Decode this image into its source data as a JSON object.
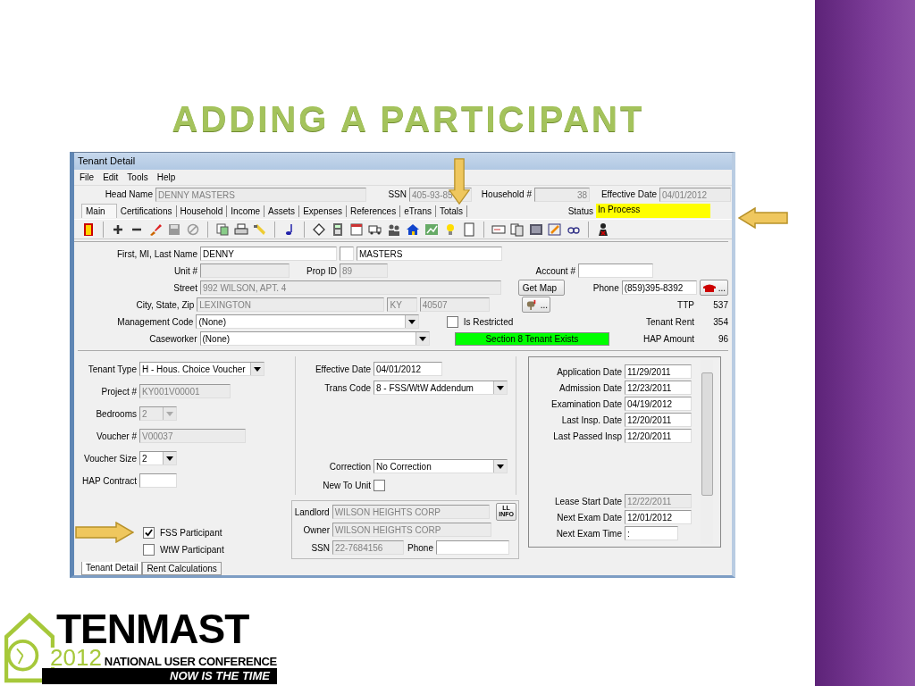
{
  "slide": {
    "title": "ADDING A PARTICIPANT"
  },
  "window": {
    "title": "Tenant Detail"
  },
  "menu": [
    "File",
    "Edit",
    "Tools",
    "Help"
  ],
  "header": [
    {
      "label": "Head Name",
      "value": "DENNY MASTERS",
      "disabled": true
    },
    {
      "label": "SSN",
      "value": "405-93-85",
      "disabled": true
    },
    {
      "label": "Household #",
      "value": "38",
      "disabled": true
    },
    {
      "label": "Effective Date",
      "value": "04/01/2012",
      "disabled": true
    }
  ],
  "tabs": [
    {
      "label": "Main",
      "selected": true
    },
    {
      "label": "Certifications",
      "selected": false
    },
    {
      "label": "Household",
      "selected": false
    },
    {
      "label": "Income",
      "selected": false
    },
    {
      "label": "Assets",
      "selected": false
    },
    {
      "label": "Expenses",
      "selected": false
    },
    {
      "label": "References",
      "selected": false
    },
    {
      "label": "eTrans",
      "selected": false
    },
    {
      "label": "Totals",
      "selected": false
    }
  ],
  "status": {
    "label": "Status",
    "value": "In Process"
  },
  "name": {
    "label": "First, MI, Last Name",
    "first": "DENNY",
    "last": "MASTERS"
  },
  "unit": {
    "label": "Unit #",
    "disabled": true
  },
  "prop_id": {
    "label": "Prop ID",
    "value": "89",
    "disabled": true
  },
  "street": {
    "label": "Street",
    "value": "992 WILSON, APT. 4",
    "disabled": true
  },
  "city": {
    "label": "City, State, Zip",
    "value": "LEXINGTON",
    "disabled": true
  },
  "state": {
    "value": "KY",
    "disabled": true
  },
  "zip": {
    "value": "40507",
    "disabled": true
  },
  "management_code": {
    "label": "Management Code",
    "value": "(None)"
  },
  "caseworker": {
    "label": "Caseworker",
    "value": "(None)"
  },
  "get_map_button": "Get Map",
  "map_button": "...",
  "account": {
    "label": "Account #"
  },
  "phone": {
    "label": "Phone",
    "value": "(859)395-8392"
  },
  "dial_button": "...",
  "is_restricted": {
    "label": "Is Restricted",
    "checked": false
  },
  "banner": "Section 8 Tenant Exists",
  "amounts": [
    {
      "label": "TTP",
      "value": "537"
    },
    {
      "label": "Tenant Rent",
      "value": "354"
    },
    {
      "label": "HAP Amount",
      "value": "96"
    }
  ],
  "tenant_type": {
    "label": "Tenant Type",
    "value": "H - Hous. Choice Voucher"
  },
  "project": {
    "label": "Project #",
    "value": "KY001V00001",
    "disabled": true
  },
  "bedrooms": {
    "label": "Bedrooms",
    "value": "2",
    "disabled": true
  },
  "voucher_number": {
    "label": "Voucher #",
    "value": "V00037",
    "disabled": true
  },
  "voucher_size": {
    "label": "Voucher Size",
    "value": "2"
  },
  "hap_contract": {
    "label": "HAP Contract"
  },
  "participation": [
    {
      "label": "FSS Participant",
      "checked": true
    },
    {
      "label": "WtW Participant",
      "checked": false
    }
  ],
  "effective_date": {
    "label": "Effective Date",
    "value": "04/01/2012"
  },
  "trans_code": {
    "label": "Trans Code",
    "value": "8 - FSS/WtW Addendum"
  },
  "correction": {
    "label": "Correction",
    "value": "No Correction"
  },
  "new_to_unit": {
    "label": "New To Unit",
    "checked": false
  },
  "landlord": {
    "label": "Landlord",
    "value": "WILSON HEIGHTS CORP",
    "disabled": true
  },
  "info_button": {
    "line1": "LL",
    "line2": "INFO"
  },
  "owner": {
    "label": "Owner",
    "value": "WILSON HEIGHTS CORP",
    "disabled": true
  },
  "landlord_ssn": {
    "label": "SSN",
    "value": "22-7684156",
    "disabled": true
  },
  "landlord_phone": {
    "label": "Phone"
  },
  "dates_top": [
    {
      "label": "Application Date",
      "value": "11/29/2011"
    },
    {
      "label": "Admission Date",
      "value": "12/23/2011"
    },
    {
      "label": "Examination Date",
      "value": "04/19/2012"
    },
    {
      "label": "Last Insp. Date",
      "value": "12/20/2011"
    },
    {
      "label": "Last Passed Insp",
      "value": "12/20/2011"
    }
  ],
  "dates_bottom": [
    {
      "label": "Lease Start Date",
      "value": "12/22/2011",
      "disabled": true
    },
    {
      "label": "Next Exam Date",
      "value": "12/01/2012"
    },
    {
      "label": "Next Exam Time",
      "value": ":"
    }
  ],
  "bottom_tabs": [
    {
      "label": "Tenant Detail",
      "selected": true
    },
    {
      "label": "Rent Calculations",
      "selected": false
    }
  ],
  "logo": {
    "name": "TENMAST",
    "year": "2012",
    "subtitle": "NATIONAL USER CONFERENCE",
    "tagline": "NOW IS THE TIME"
  }
}
